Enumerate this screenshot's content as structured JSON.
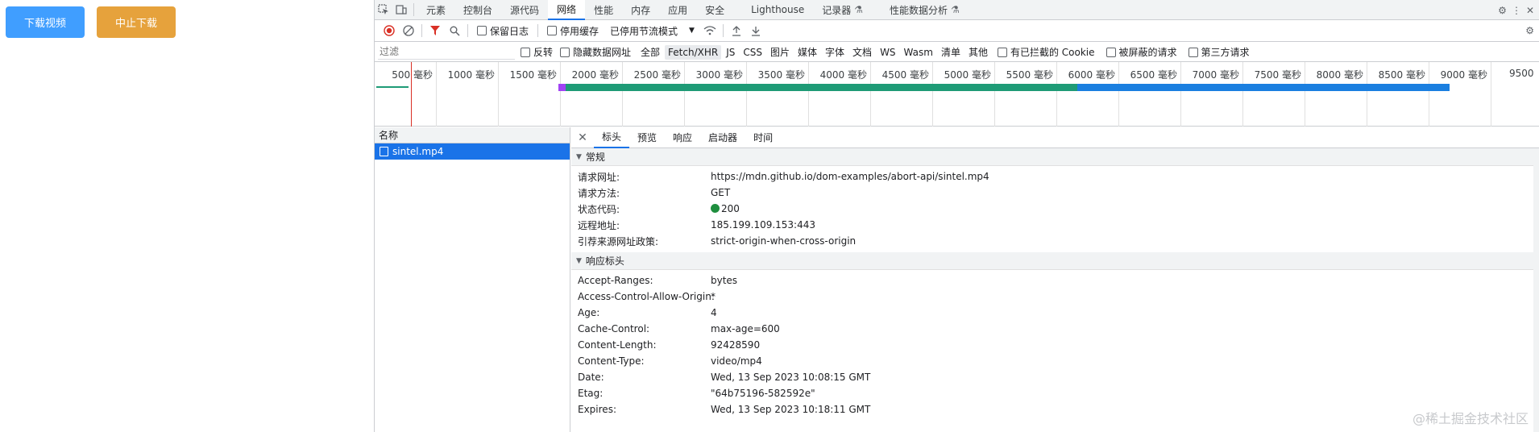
{
  "page": {
    "download_button": "下载视频",
    "abort_button": "中止下载",
    "colors": {
      "primary": "#409eff",
      "warning": "#e6a23c"
    }
  },
  "devtools": {
    "tabs": [
      "元素",
      "控制台",
      "源代码",
      "网络",
      "性能",
      "内存",
      "应用",
      "安全",
      "Lighthouse",
      "记录器",
      "性能数据分析"
    ],
    "active_tab": "网络",
    "toolbar": {
      "preserve_log": "保留日志",
      "disable_cache": "停用缓存",
      "throttle": "已停用节流模式"
    },
    "filter": {
      "placeholder": "过滤",
      "invert": "反转",
      "hide_data_urls": "隐藏数据网址",
      "types": [
        "全部",
        "Fetch/XHR",
        "JS",
        "CSS",
        "图片",
        "媒体",
        "字体",
        "文档",
        "WS",
        "Wasm",
        "清单",
        "其他"
      ],
      "active_type": "Fetch/XHR",
      "blocked_cookies": "有已拦截的 Cookie",
      "blocked_requests": "被屏蔽的请求",
      "third_party": "第三方请求"
    },
    "timeline_ticks": [
      "500 毫秒",
      "1000 毫秒",
      "1500 毫秒",
      "2000 毫秒",
      "2500 毫秒",
      "3000 毫秒",
      "3500 毫秒",
      "4000 毫秒",
      "4500 毫秒",
      "5000 毫秒",
      "5500 毫秒",
      "6000 毫秒",
      "6500 毫秒",
      "7000 毫秒",
      "7500 毫秒",
      "8000 毫秒",
      "8500 毫秒",
      "9000 毫秒",
      "9500"
    ],
    "requests": {
      "header": "名称",
      "items": [
        "sintel.mp4"
      ]
    },
    "detail_tabs": [
      "标头",
      "预览",
      "响应",
      "启动器",
      "时间"
    ],
    "general": {
      "title": "常规",
      "rows": [
        {
          "k": "请求网址:",
          "v": "https://mdn.github.io/dom-examples/abort-api/sintel.mp4"
        },
        {
          "k": "请求方法:",
          "v": "GET"
        },
        {
          "k": "状态代码:",
          "v": "200"
        },
        {
          "k": "远程地址:",
          "v": "185.199.109.153:443"
        },
        {
          "k": "引荐来源网址政策:",
          "v": "strict-origin-when-cross-origin"
        }
      ]
    },
    "response_headers": {
      "title": "响应标头",
      "rows": [
        {
          "k": "Accept-Ranges:",
          "v": "bytes"
        },
        {
          "k": "Access-Control-Allow-Origin:",
          "v": "*"
        },
        {
          "k": "Age:",
          "v": "4"
        },
        {
          "k": "Cache-Control:",
          "v": "max-age=600"
        },
        {
          "k": "Content-Length:",
          "v": "92428590"
        },
        {
          "k": "Content-Type:",
          "v": "video/mp4"
        },
        {
          "k": "Date:",
          "v": "Wed, 13 Sep 2023 10:08:15 GMT"
        },
        {
          "k": "Etag:",
          "v": "\"64b75196-582592e\""
        },
        {
          "k": "Expires:",
          "v": "Wed, 13 Sep 2023 10:18:11 GMT"
        }
      ]
    },
    "watermark": "@稀土掘金技术社区"
  }
}
